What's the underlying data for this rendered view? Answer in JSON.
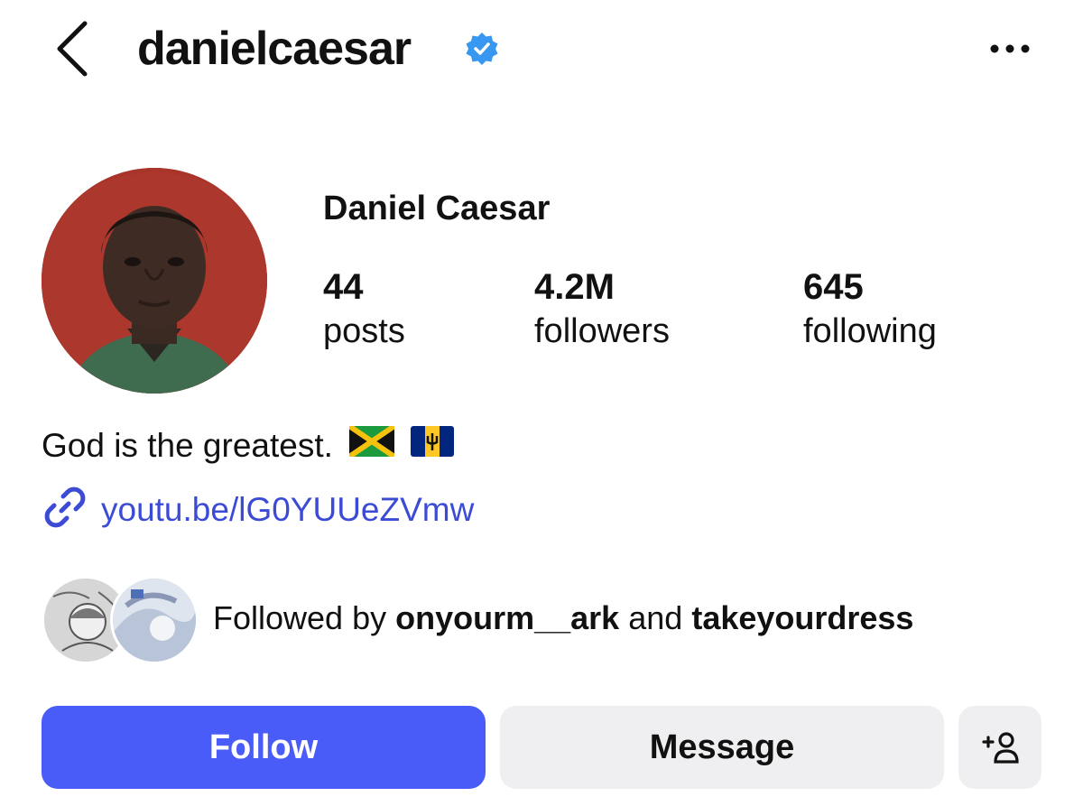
{
  "header": {
    "username": "danielcaesar"
  },
  "profile": {
    "display_name": "Daniel Caesar",
    "stats": {
      "posts": {
        "value": "44",
        "label": "posts"
      },
      "followers": {
        "value": "4.2M",
        "label": "followers"
      },
      "following": {
        "value": "645",
        "label": "following"
      }
    },
    "bio": "God is the greatest.",
    "link": "youtu.be/lG0YUUeZVmw"
  },
  "followed_by": {
    "prefix": "Followed by",
    "user1": "onyourm__ark",
    "joiner": "and",
    "user2": "takeyourdress"
  },
  "actions": {
    "follow_label": "Follow",
    "message_label": "Message"
  },
  "colors": {
    "accent": "#4a5cf7",
    "link": "#3b4bd6",
    "verified": "#3897f0",
    "secondary_button": "#efeff1"
  },
  "icons": [
    "back-icon",
    "verified-badge-icon",
    "more-icon",
    "link-icon",
    "jamaica-flag-icon",
    "barbados-flag-icon",
    "add-person-icon"
  ]
}
